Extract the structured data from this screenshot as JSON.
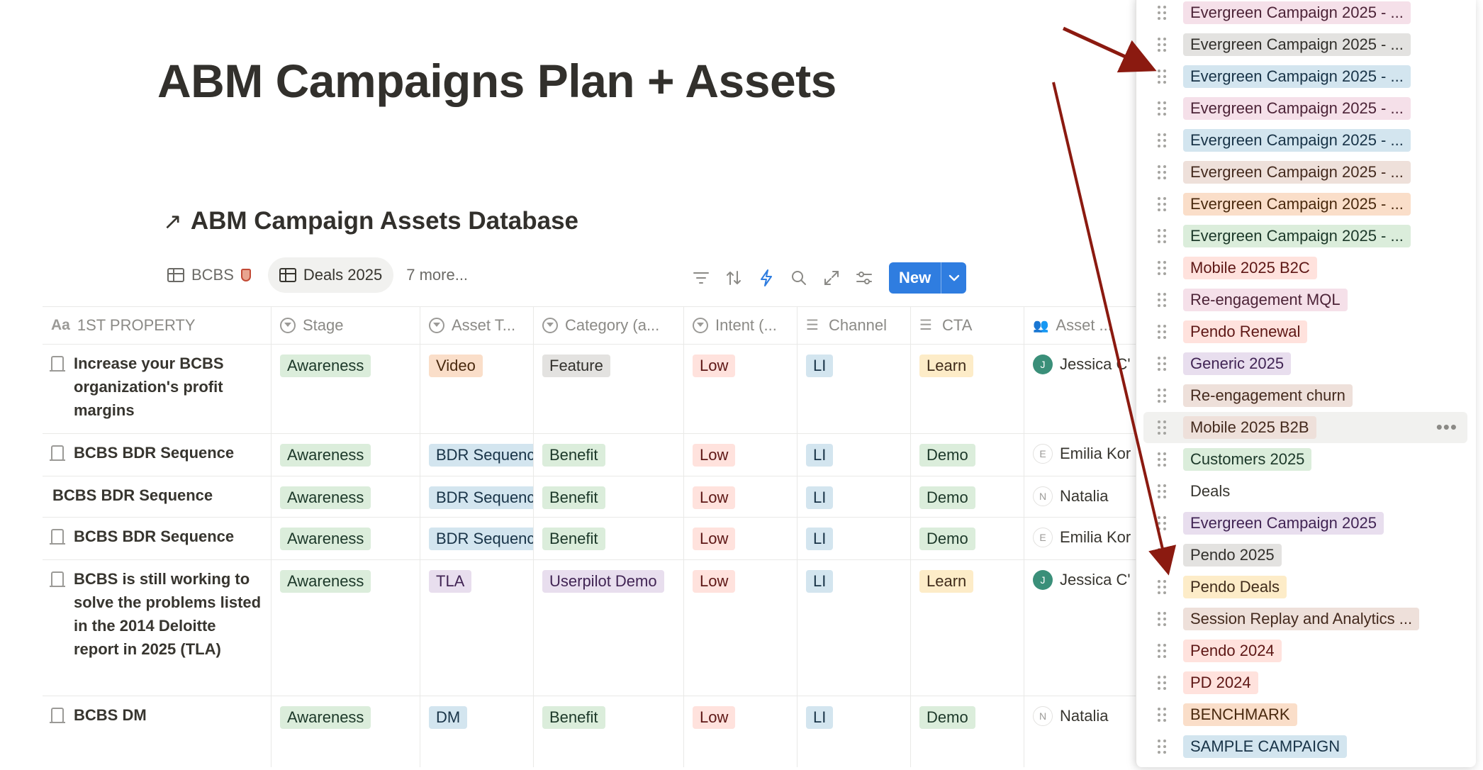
{
  "page": {
    "title": "ABM Campaigns Plan + Assets"
  },
  "database": {
    "title": "ABM Campaign Assets Database",
    "link_icon": "arrow-up-right-icon"
  },
  "views": {
    "tabs": [
      {
        "label": "BCBS",
        "icon": "table-icon",
        "suffix_icon": "shield-emoji"
      },
      {
        "label": "Deals 2025",
        "icon": "table-icon",
        "active": true
      }
    ],
    "more_label": "7 more..."
  },
  "toolbar": {
    "icons": [
      "filter-icon",
      "sort-icon",
      "automation-bolt-icon",
      "search-icon",
      "expand-icon",
      "settings-sliders-icon"
    ],
    "new_label": "New",
    "new_dropdown_icon": "chevron-down-icon",
    "accent_color": "#2f7de0"
  },
  "table": {
    "columns": [
      {
        "label": "1ST PROPERTY",
        "icon": "text-property-icon"
      },
      {
        "label": "Stage",
        "icon": "select-icon"
      },
      {
        "label": "Asset T...",
        "icon": "select-icon"
      },
      {
        "label": "Category (a...",
        "icon": "select-icon"
      },
      {
        "label": "Intent (...",
        "icon": "select-icon"
      },
      {
        "label": "Channel",
        "icon": "list-icon"
      },
      {
        "label": "CTA",
        "icon": "list-icon"
      },
      {
        "label": "Asset ...",
        "icon": "people-icon"
      }
    ],
    "rows": [
      {
        "name": "Increase your BCBS organization's profit margins",
        "stage": "Awareness",
        "asset_type": "Video",
        "category": "Feature",
        "intent": "Low",
        "channel": "LI",
        "cta": "Learn",
        "owner": "Jessica C'",
        "owner_initial": "J"
      },
      {
        "name": "BCBS BDR Sequence",
        "stage": "Awareness",
        "asset_type": "BDR Sequence",
        "category": "Benefit",
        "intent": "Low",
        "channel": "LI",
        "cta": "Demo",
        "owner": "Emilia Kor",
        "owner_initial": "E"
      },
      {
        "name": "BCBS BDR Sequence",
        "stage": "Awareness",
        "asset_type": "BDR Sequence",
        "category": "Benefit",
        "intent": "Low",
        "channel": "LI",
        "cta": "Demo",
        "owner": "Natalia",
        "owner_initial": "N"
      },
      {
        "name": "BCBS BDR Sequence",
        "stage": "Awareness",
        "asset_type": "BDR Sequence",
        "category": "Benefit",
        "intent": "Low",
        "channel": "LI",
        "cta": "Demo",
        "owner": "Emilia Kor",
        "owner_initial": "E"
      },
      {
        "name": "BCBS is still working to solve the problems listed in the 2014 Deloitte report in 2025 (TLA)",
        "stage": "Awareness",
        "asset_type": "TLA",
        "category": "Userpilot Demo",
        "intent": "Low",
        "channel": "LI",
        "cta": "Learn",
        "owner": "Jessica C'",
        "owner_initial": "J"
      },
      {
        "name": "BCBS DM",
        "stage": "Awareness",
        "asset_type": "DM",
        "category": "Benefit",
        "intent": "Low",
        "channel": "LI",
        "cta": "Demo",
        "owner": "Natalia",
        "owner_initial": "N"
      }
    ]
  },
  "campaign_options": [
    {
      "label": "Evergreen Campaign 2025 - ...",
      "color": "pink"
    },
    {
      "label": "Evergreen Campaign 2025 - ...",
      "color": "gray"
    },
    {
      "label": "Evergreen Campaign 2025 - ...",
      "color": "blue"
    },
    {
      "label": "Evergreen Campaign 2025 - ...",
      "color": "pink"
    },
    {
      "label": "Evergreen Campaign 2025 - ...",
      "color": "blue"
    },
    {
      "label": "Evergreen Campaign 2025 - ...",
      "color": "brown"
    },
    {
      "label": "Evergreen Campaign 2025 - ...",
      "color": "orange"
    },
    {
      "label": "Evergreen Campaign 2025 - ...",
      "color": "green"
    },
    {
      "label": "Mobile 2025 B2C",
      "color": "red"
    },
    {
      "label": "Re-engagement MQL",
      "color": "pink"
    },
    {
      "label": "Pendo Renewal",
      "color": "red"
    },
    {
      "label": "Generic 2025",
      "color": "purple"
    },
    {
      "label": "Re-engagement churn",
      "color": "brown"
    },
    {
      "label": "Mobile 2025 B2B",
      "color": "brown",
      "hovered": true
    },
    {
      "label": "Customers 2025",
      "color": "green"
    },
    {
      "label": "Deals",
      "color": "default"
    },
    {
      "label": "Evergreen Campaign 2025",
      "color": "purple"
    },
    {
      "label": "Pendo 2025",
      "color": "gray"
    },
    {
      "label": "Pendo Deals",
      "color": "yellow"
    },
    {
      "label": "Session Replay and Analytics ...",
      "color": "brown"
    },
    {
      "label": "Pendo 2024",
      "color": "red"
    },
    {
      "label": "PD 2024",
      "color": "red"
    },
    {
      "label": "BENCHMARK",
      "color": "orange"
    },
    {
      "label": "SAMPLE CAMPAIGN",
      "color": "blue"
    }
  ],
  "annotation": {
    "arrow_color": "#8b1a10"
  },
  "tag_colors": {
    "Awareness": "green",
    "Video": "orange",
    "Feature": "gray",
    "Low": "red",
    "LI": "blue",
    "Learn": "yellow",
    "Demo": "green",
    "BDR Sequence": "blue",
    "Benefit": "green",
    "TLA": "purple",
    "Userpilot Demo": "purple",
    "DM": "blue"
  }
}
